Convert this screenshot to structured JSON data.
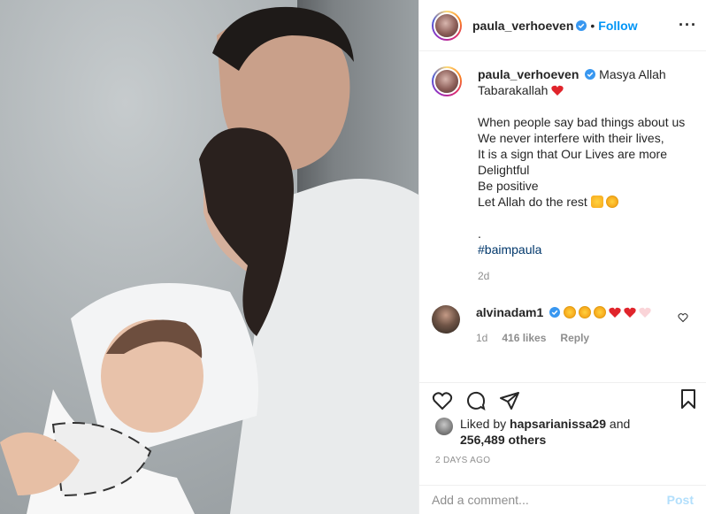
{
  "post": {
    "username": "paula_verhoeven",
    "follow_label": "Follow",
    "caption_first": "Masya Allah Tabarakallah",
    "caption_lines": "When people say bad things about us\nWe never interfere with their lives,\nIt is a sign that Our Lives are more Delightful\nBe positive\nLet Allah do the rest",
    "dot": ".",
    "hashtag": "#baimpaula",
    "time_ago": "2d"
  },
  "reply": {
    "username": "alvinadam1",
    "time_ago": "1d",
    "likes": "416 likes",
    "reply_label": "Reply"
  },
  "likes": {
    "prefix": "Liked by",
    "user": "hapsarianissa29",
    "and": "and",
    "others": "256,489 others"
  },
  "date_label": "2 DAYS AGO",
  "composer": {
    "placeholder": "Add a comment...",
    "post_label": "Post"
  },
  "colors": {
    "accent": "#0095f6",
    "muted": "#8e8e8e",
    "heart": "#ed4956"
  }
}
